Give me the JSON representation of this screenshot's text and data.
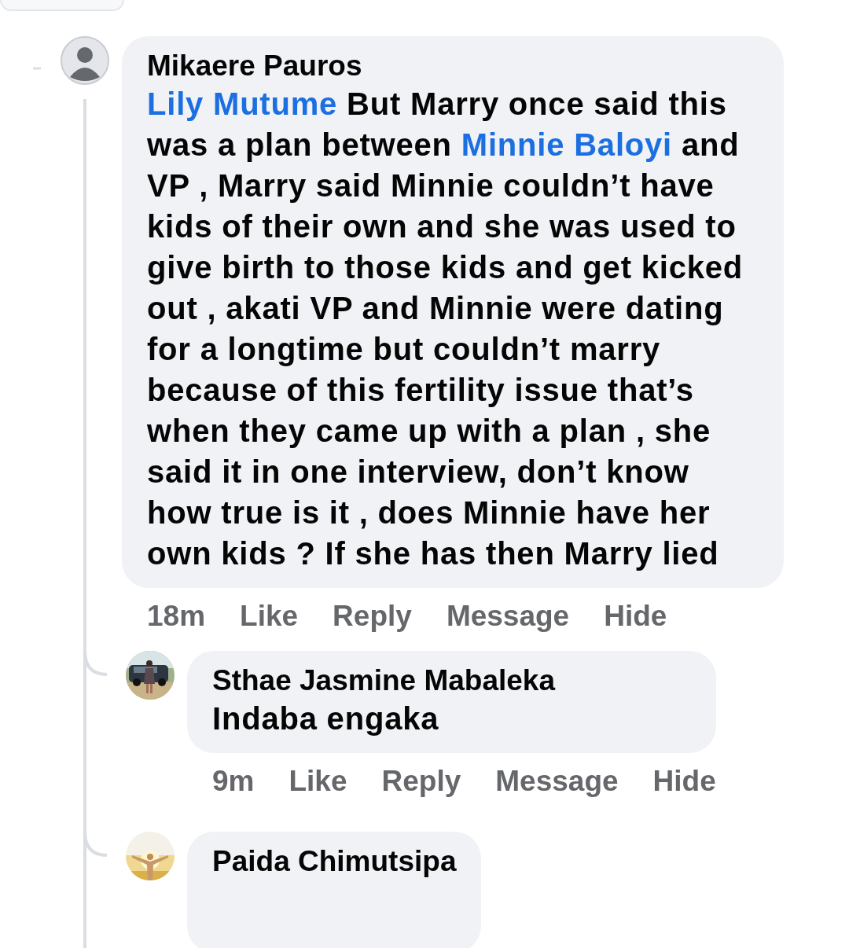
{
  "comments": [
    {
      "author": "Mikaere Pauros",
      "avatar": {
        "kind": "default"
      },
      "body": [
        {
          "kind": "mention",
          "text": "Lily Mutume"
        },
        {
          "kind": "text",
          "text": " But Marry once said this was a plan between "
        },
        {
          "kind": "mention",
          "text": "Minnie Baloyi"
        },
        {
          "kind": "text",
          "text": " and VP , Marry said Minnie couldn’t have kids of their own and she was used to give birth to those kids and get kicked out , akati VP and Minnie were dating for a longtime but couldn’t marry because of this fertility issue that’s when they came up with a plan , she said it in one interview, don’t know how true is it , does Minnie have her own kids ? If she has then Marry lied"
        }
      ],
      "time": "18m",
      "actions": [
        "Like",
        "Reply",
        "Message",
        "Hide"
      ],
      "replies": [
        {
          "author": "Sthae Jasmine Mabaleka",
          "avatar": {
            "kind": "car"
          },
          "body": [
            {
              "kind": "text",
              "text": "Indaba engaka"
            }
          ],
          "time": "9m",
          "actions": [
            "Like",
            "Reply",
            "Message",
            "Hide"
          ]
        },
        {
          "author": "Paida Chimutsipa",
          "avatar": {
            "kind": "sunrise"
          }
        }
      ]
    }
  ]
}
